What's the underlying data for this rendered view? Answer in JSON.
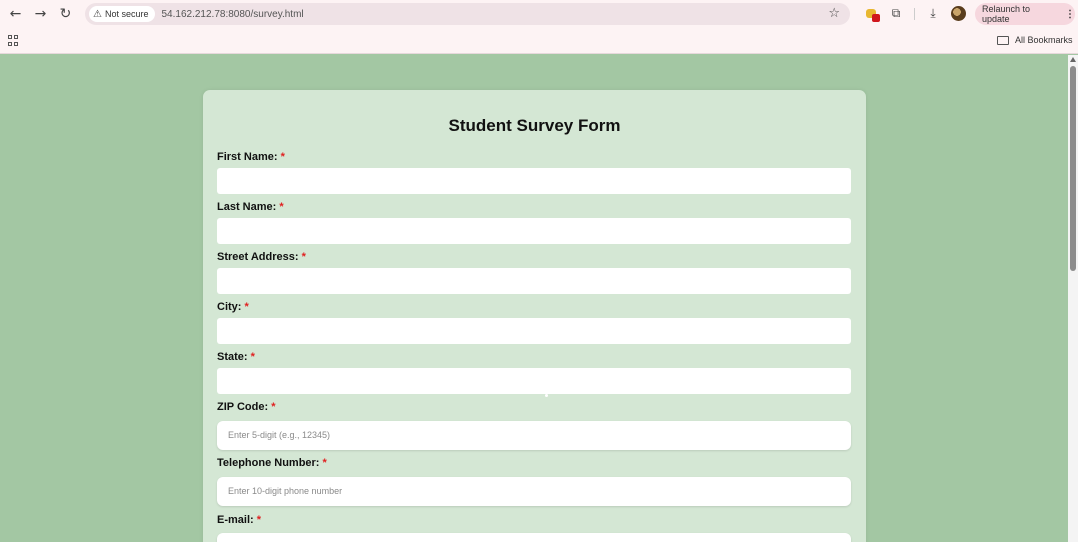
{
  "browser": {
    "security_label": "Not secure",
    "url": "54.162.212.78:8080/survey.html",
    "relaunch_label": "Relaunch to update",
    "all_bookmarks_label": "All Bookmarks",
    "icons": [
      "back-icon",
      "forward-icon",
      "reload-icon",
      "warning-icon",
      "star-icon",
      "extension-icon",
      "puzzle-icon",
      "download-icon",
      "profile-avatar",
      "menu-icon",
      "apps-icon",
      "folder-icon"
    ]
  },
  "form": {
    "title": "Student Survey Form",
    "required_marker": "*",
    "fields": [
      {
        "label": "First Name:",
        "placeholder": "",
        "value": ""
      },
      {
        "label": "Last Name:",
        "placeholder": "",
        "value": ""
      },
      {
        "label": "Street Address:",
        "placeholder": "",
        "value": ""
      },
      {
        "label": "City:",
        "placeholder": "",
        "value": ""
      },
      {
        "label": "State:",
        "placeholder": "",
        "value": ""
      },
      {
        "label": "ZIP Code:",
        "placeholder": "Enter 5-digit (e.g., 12345)",
        "value": ""
      },
      {
        "label": "Telephone Number:",
        "placeholder": "Enter 10-digit phone number",
        "value": ""
      },
      {
        "label": "E-mail:",
        "placeholder": "",
        "value": ""
      }
    ]
  },
  "colors": {
    "page_background": "#a3c7a3",
    "card_background": "#d4e7d4",
    "required_marker": "#e02020",
    "chrome_background": "#fdf3f4"
  }
}
